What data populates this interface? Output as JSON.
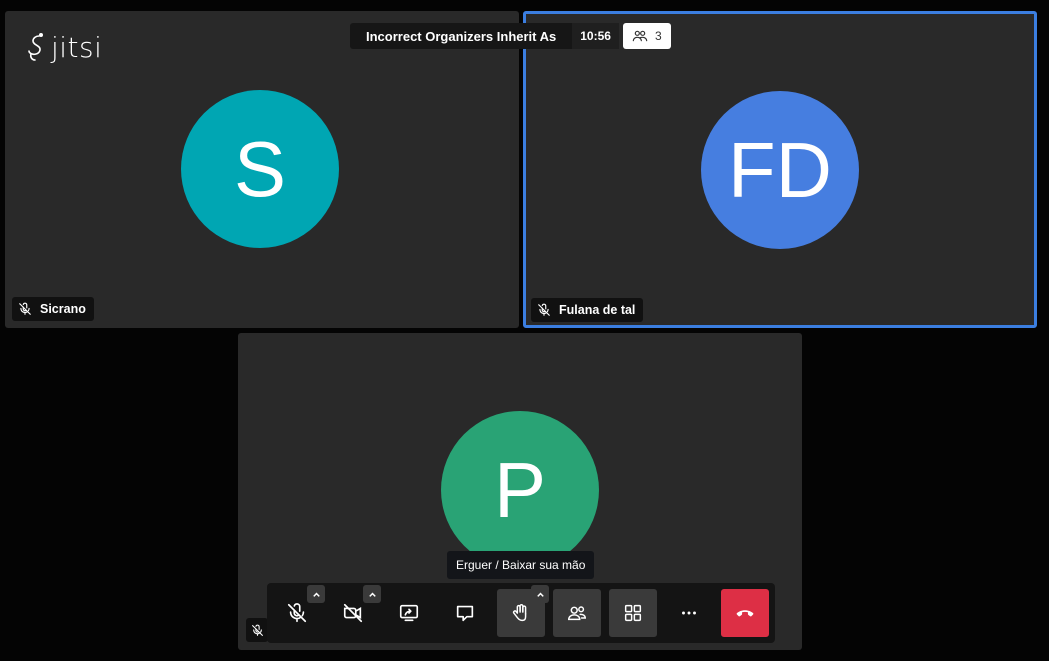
{
  "conference": {
    "subject": "Incorrect Organizers Inherit As",
    "timer": "10:56",
    "participant_count": "3",
    "logo_text": "jitsi"
  },
  "participants": [
    {
      "initials": "S",
      "name": "Sicrano",
      "color": "#00a6b3",
      "muted": true
    },
    {
      "initials": "FD",
      "name": "Fulana de tal",
      "color": "#467ee0",
      "muted": true,
      "dominant_speaker": true
    },
    {
      "initials": "P",
      "name": "",
      "color": "#29a375",
      "muted": true
    }
  ],
  "tooltip": {
    "text": "Erguer / Baixar sua mão"
  },
  "toolbar": {
    "buttons": [
      {
        "id": "microphone",
        "icon": "mic-off-icon"
      },
      {
        "id": "camera",
        "icon": "camera-off-icon"
      },
      {
        "id": "share-screen",
        "icon": "share-screen-icon"
      },
      {
        "id": "chat",
        "icon": "chat-icon"
      },
      {
        "id": "raise-hand",
        "icon": "hand-icon"
      },
      {
        "id": "participants",
        "icon": "participants-icon"
      },
      {
        "id": "tile-view",
        "icon": "grid-icon"
      },
      {
        "id": "more",
        "icon": "more-icon"
      },
      {
        "id": "hangup",
        "icon": "hangup-icon"
      }
    ]
  },
  "colors": {
    "background": "#040404",
    "tile": "#292929",
    "active_border": "#3b7ee0",
    "hangup": "#dd2f45"
  }
}
